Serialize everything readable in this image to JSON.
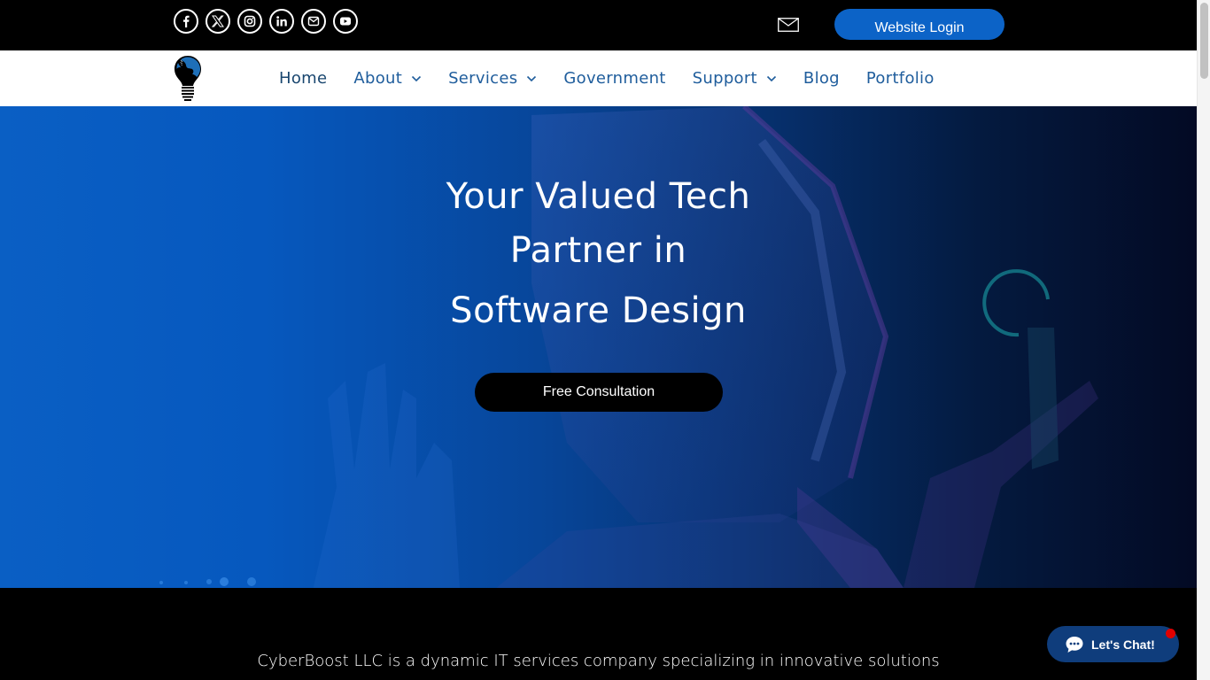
{
  "topbar": {
    "social_links": [
      {
        "name": "facebook",
        "icon": "facebook-icon",
        "glyph": "f"
      },
      {
        "name": "x",
        "icon": "x-icon",
        "glyph": "X"
      },
      {
        "name": "instagram",
        "icon": "instagram-icon",
        "glyph": ""
      },
      {
        "name": "linkedin",
        "icon": "linkedin-icon",
        "glyph": "in"
      },
      {
        "name": "email",
        "icon": "mail-icon",
        "glyph": ""
      },
      {
        "name": "youtube",
        "icon": "youtube-icon",
        "glyph": ""
      }
    ],
    "mail_icon": "envelope-icon",
    "login_label": "Website Login"
  },
  "nav": {
    "logo": "lightbulb-globe-logo",
    "items": [
      {
        "label": "Home",
        "has_dropdown": false,
        "active": true
      },
      {
        "label": "About",
        "has_dropdown": true
      },
      {
        "label": "Services",
        "has_dropdown": true
      },
      {
        "label": "Government",
        "has_dropdown": false
      },
      {
        "label": "Support",
        "has_dropdown": true
      },
      {
        "label": "Blog",
        "has_dropdown": false
      },
      {
        "label": "Portfolio",
        "has_dropdown": false
      }
    ]
  },
  "hero": {
    "title_lines": [
      "Your Valued Tech",
      "Partner in",
      "Software Design"
    ],
    "cta_label": "Free Consultation"
  },
  "about": {
    "text": "CyberBoost LLC is a dynamic IT services company specializing in innovative solutions"
  },
  "chat": {
    "label": "Let's Chat!",
    "icon": "chat-bubble-icon",
    "notification": true
  },
  "colors": {
    "topbar_bg": "#000000",
    "login_button": "#0c63c7",
    "nav_text": "#1f5d9c",
    "chat_bg": "#0f3d7c",
    "chat_dot": "#e00000",
    "cta_bg": "#000000"
  }
}
